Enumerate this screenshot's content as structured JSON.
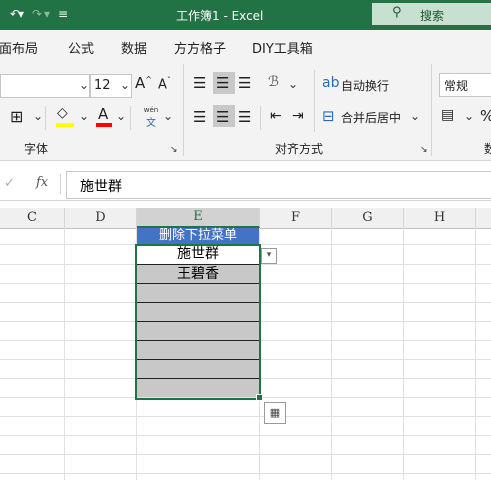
{
  "titlebar": {
    "title": "工作簿1  -  Excel",
    "search_label": "搜索"
  },
  "tabs": [
    "页面布局",
    "公式",
    "数据",
    "方方格子",
    "DIY工具箱"
  ],
  "ribbon": {
    "font_size": "12",
    "font_group_label": "字体",
    "align_group_label": "对齐方式",
    "wrap_text": "自动换行",
    "merge_center": "合并后居中",
    "number_format": "常规",
    "number_group_label_partial": "数",
    "wen_glyph": "wén",
    "wen_char": "文"
  },
  "formula_bar": {
    "fx": "fx",
    "value": "施世群"
  },
  "columns": [
    "C",
    "D",
    "E",
    "F",
    "G",
    "H"
  ],
  "cells": {
    "e_header": "删除下拉菜单",
    "e2": "施世群",
    "e3": "王碧香"
  },
  "colors": {
    "excel_green": "#217346",
    "header_fill": "#4472c4",
    "gray_fill": "#c8c8c8"
  }
}
